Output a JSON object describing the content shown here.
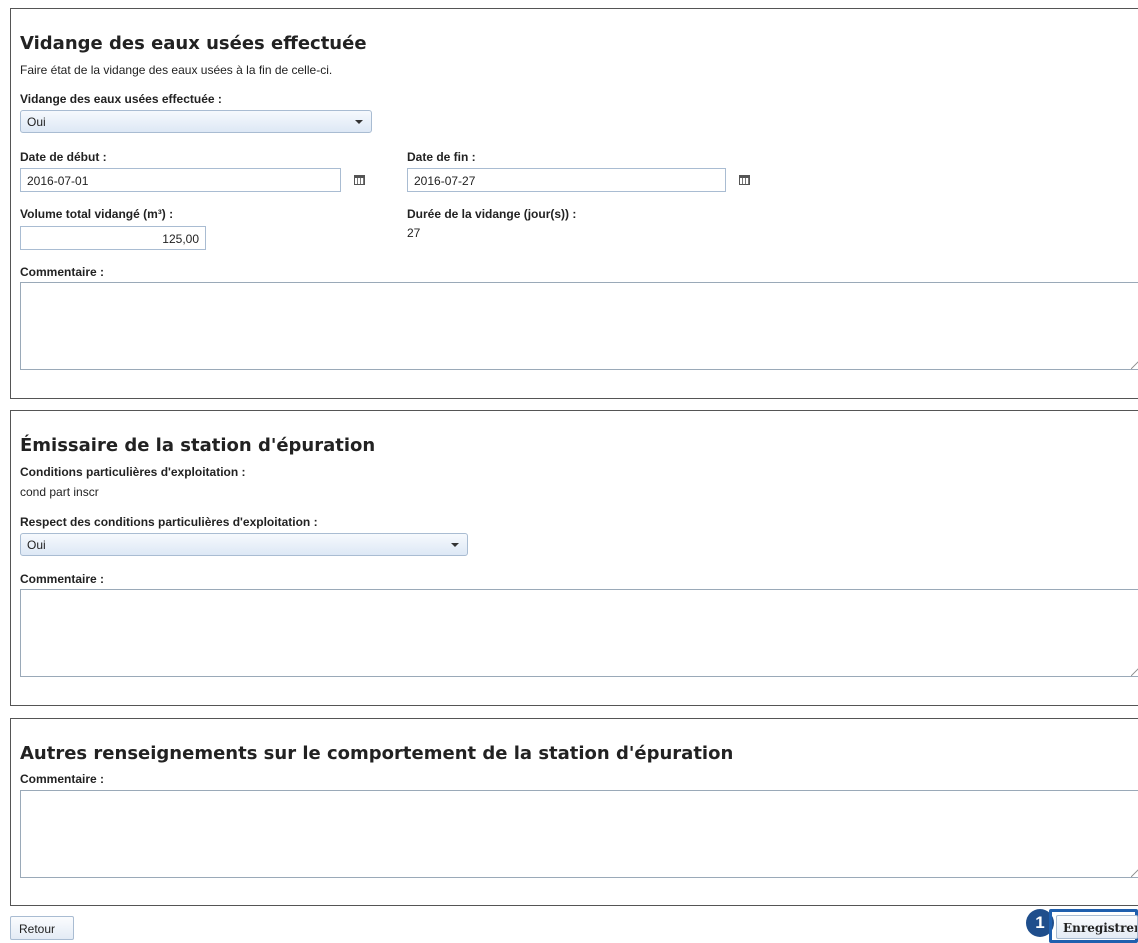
{
  "section1": {
    "title": "Vidange des eaux usées effectuée",
    "description": "Faire état de la vidange des eaux usées à la fin de celle-ci.",
    "vidange_label": "Vidange des eaux usées effectuée :",
    "vidange_value": "Oui",
    "date_debut_label": "Date de début :",
    "date_debut_value": "2016-07-01",
    "date_fin_label": "Date de fin :",
    "date_fin_value": "2016-07-27",
    "volume_label": "Volume total vidangé (m³) :",
    "volume_value": "125,00",
    "duree_label": "Durée de la vidange (jour(s)) :",
    "duree_value": "27",
    "commentaire_label": "Commentaire :"
  },
  "section2": {
    "title": "Émissaire de la station d'épuration",
    "conditions_label": "Conditions particulières d'exploitation :",
    "conditions_value": "cond part inscr",
    "respect_label": "Respect des conditions particulières d'exploitation :",
    "respect_value": "Oui",
    "commentaire_label": "Commentaire :"
  },
  "section3": {
    "title": "Autres renseignements sur le comportement de la station d'épuration",
    "commentaire_label": "Commentaire :"
  },
  "footer": {
    "retour_label": "Retour",
    "enregistrer_label": "Enregistrer",
    "step_badge": "1"
  },
  "colors": {
    "badge": "#1f4e8c",
    "highlight": "#1f5fae",
    "field_border": "#a9bcd2"
  },
  "icons": {
    "calendar": "calendar-icon",
    "dropdown": "chevron-down-icon"
  }
}
